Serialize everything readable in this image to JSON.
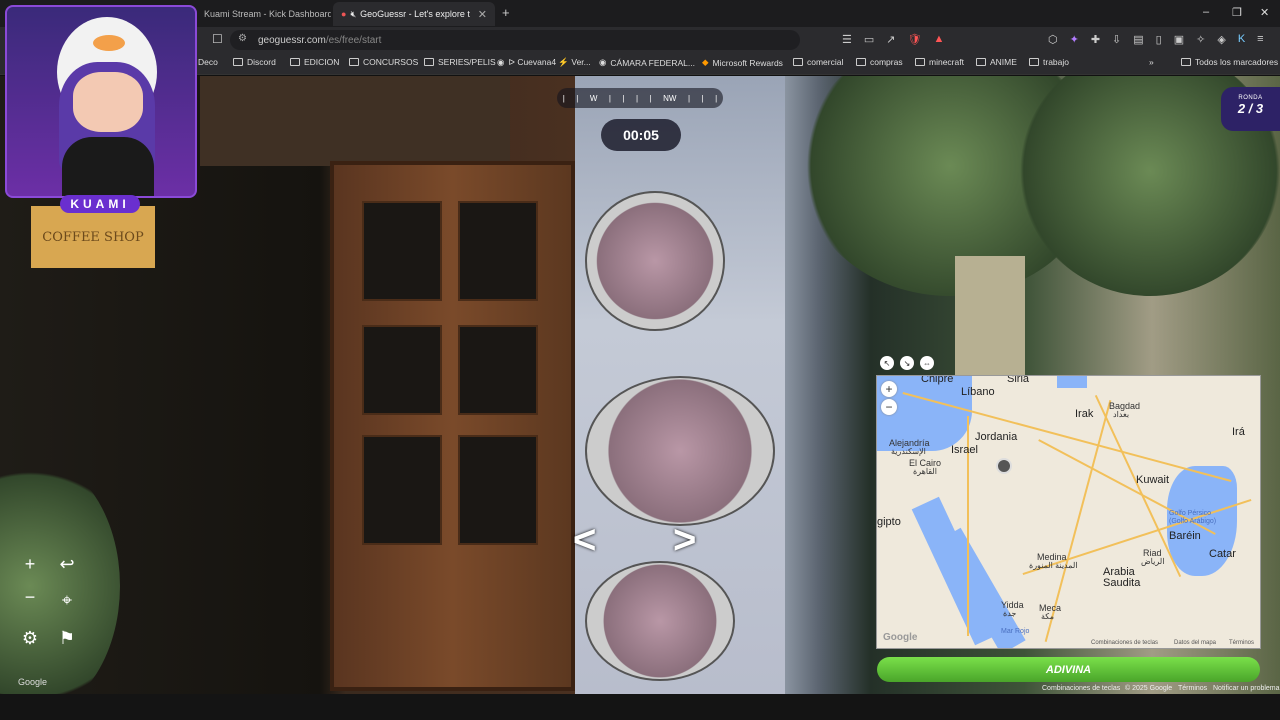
{
  "browser": {
    "tabs": [
      {
        "title": "Kuami Stream - Kick Dashboard",
        "active": false
      },
      {
        "title": "GeoGuessr - Let's explore the",
        "active": true
      }
    ],
    "new_tab": "+",
    "window_controls": {
      "minimize": "–",
      "restore": "❐",
      "close": "✕"
    },
    "url": {
      "domain": "geoguessr.com",
      "path": "/es/free/start"
    }
  },
  "bookmarks": [
    {
      "label": "Deco",
      "icon": "folder"
    },
    {
      "label": "Discord",
      "icon": "folder"
    },
    {
      "label": "EDICION",
      "icon": "folder"
    },
    {
      "label": "CONCURSOS",
      "icon": "folder"
    },
    {
      "label": "SERIES/PELIS",
      "icon": "folder"
    },
    {
      "label": "ᐅ Cuevana4 ⚡ Ver...",
      "icon": "globe"
    },
    {
      "label": "CÁMARA FEDERAL...",
      "icon": "globe"
    },
    {
      "label": "Microsoft Rewards",
      "icon": "ms"
    },
    {
      "label": "comercial",
      "icon": "folder"
    },
    {
      "label": "compras",
      "icon": "folder"
    },
    {
      "label": "minecraft",
      "icon": "folder"
    },
    {
      "label": "ANIME",
      "icon": "folder"
    },
    {
      "label": "trabajo",
      "icon": "folder"
    }
  ],
  "bookmarks_more": "»",
  "bookmarks_all": "Todos los marcadores",
  "game": {
    "compass": {
      "w": "W",
      "nw": "NW"
    },
    "timer": "00:05",
    "round_label": "RONDA",
    "round_value": "2 / 3",
    "sign_text": "COFFEE SHOP",
    "streamer_name": "KUAMI",
    "guess_button": "ADIVINA",
    "google_watermark": "Google"
  },
  "map": {
    "labels": {
      "chipre": "Chipre",
      "siria": "Siria",
      "libano": "Líbano",
      "irak": "Irak",
      "bagdad": "Bagdad",
      "bagdad_ar": "بغداد",
      "ira": "Irá",
      "jordania": "Jordania",
      "alejandria": "Alejandría",
      "alejandria_ar": "الإسكندرية",
      "israel": "Israel",
      "el_cairo": "El Cairo",
      "el_cairo_ar": "القاهرة",
      "kuwait": "Kuwait",
      "gipto": "gipto",
      "golfo": "Golfo Pérsico",
      "golfo2": "(Golfo Arábigo)",
      "barein": "Baréin",
      "catar": "Catar",
      "medina": "Medina",
      "medina_ar": "المدينة المنورة",
      "riad": "Riad",
      "riad_ar": "الرياض",
      "arabia": "Arabia",
      "saudita": "Saudita",
      "yidda": "Yidda",
      "yidda_ar": "جدة",
      "meca": "Meca",
      "meca_ar": "مكة",
      "mar_rojo": "Mar Rojo"
    },
    "footer": {
      "google": "Google",
      "shortcuts": "Combinaciones de teclas",
      "data": "Datos del mapa",
      "terms": "Términos"
    },
    "zoom_in": "+",
    "zoom_out": "−"
  },
  "credits": {
    "shortcuts": "Combinaciones de teclas",
    "copyright": "© 2025 Google",
    "terms": "Términos",
    "report": "Notificar un problema"
  }
}
